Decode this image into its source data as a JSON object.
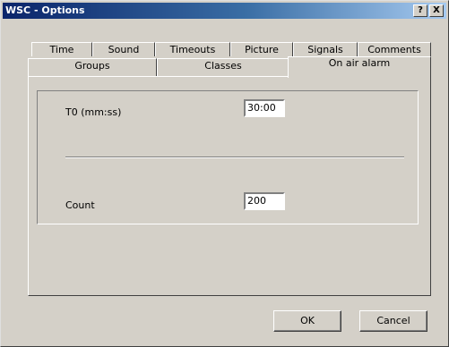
{
  "window": {
    "title": "WSC - Options",
    "help_btn": "?",
    "close_btn": "X"
  },
  "tabs_row1": [
    "Time",
    "Sound",
    "Timeouts",
    "Picture",
    "Signals",
    "Comments"
  ],
  "tabs_row2": [
    "Groups",
    "Classes",
    "On air alarm"
  ],
  "selected_tab": "On air alarm",
  "fields": {
    "t0": {
      "label": "T0 (mm:ss)",
      "value": "30:00"
    },
    "count": {
      "label": "Count",
      "value": "200"
    }
  },
  "buttons": {
    "ok": "OK",
    "cancel": "Cancel"
  }
}
